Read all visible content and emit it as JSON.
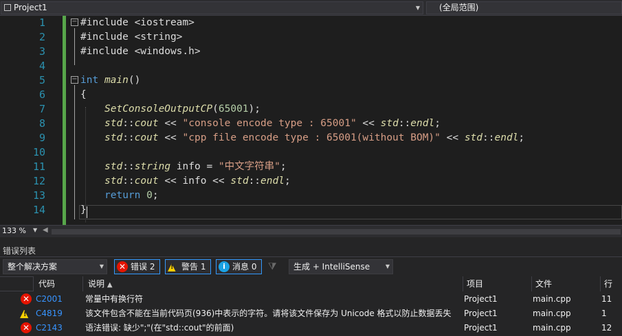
{
  "navbar": {
    "project": "Project1",
    "scope": "(全局范围)"
  },
  "editor": {
    "line_numbers": [
      "1",
      "2",
      "3",
      "4",
      "5",
      "6",
      "7",
      "8",
      "9",
      "10",
      "11",
      "12",
      "13",
      "14"
    ],
    "lines": {
      "l1": "#include <iostream>",
      "l2": "#include <string>",
      "l3": "#include <windows.h>",
      "l5_kw": "int",
      "l5_fn": "main",
      "l5_rest": "()",
      "l6": "{",
      "l7_fn": "SetConsoleOutputCP",
      "l7_open": "(",
      "l7_num": "65001",
      "l7_close": ");",
      "l8_ns": "std",
      "l8_sep": "::",
      "l8_cout": "cout",
      "l8_op": " << ",
      "l8_str": "\"console encode type : 65001\"",
      "l8_op2": " << ",
      "l8_ns2": "std",
      "l8_sep2": "::",
      "l8_endl": "endl",
      "l8_end": ";",
      "l9_ns": "std",
      "l9_sep": "::",
      "l9_cout": "cout",
      "l9_op": " << ",
      "l9_str": "\"cpp file encode type : 65001(without BOM)\"",
      "l9_op2": " << ",
      "l9_ns2": "std",
      "l9_sep2": "::",
      "l9_endl": "endl",
      "l9_end": ";",
      "l11_ns": "std",
      "l11_sep": "::",
      "l11_type": "string",
      "l11_rest": " info = ",
      "l11_str": "\"中文字符串\"",
      "l11_end": ";",
      "l12_ns": "std",
      "l12_sep": "::",
      "l12_cout": "cout",
      "l12_rest": " << info << ",
      "l12_ns2": "std",
      "l12_sep2": "::",
      "l12_endl": "endl",
      "l12_end": ";",
      "l13_kw": "return",
      "l13_num": " 0",
      "l13_end": ";",
      "l14": "}"
    }
  },
  "zoom": {
    "level": "133 %"
  },
  "errorlist": {
    "title": "错误列表",
    "scope_select": "整个解决方案",
    "errors_label": "错误 2",
    "warnings_label": "警告 1",
    "messages_label": "消息 0",
    "build_select": "生成 + IntelliSense",
    "columns": {
      "code": "代码",
      "desc": "说明",
      "sort": "▲",
      "project": "项目",
      "file": "文件",
      "line": "行"
    },
    "rows": [
      {
        "severity": "error",
        "code": "C2001",
        "desc": "常量中有换行符",
        "project": "Project1",
        "file": "main.cpp",
        "line": "11"
      },
      {
        "severity": "warning",
        "code": "C4819",
        "desc": "该文件包含不能在当前代码页(936)中表示的字符。请将该文件保存为 Unicode 格式以防止数据丢失",
        "project": "Project1",
        "file": "main.cpp",
        "line": "1"
      },
      {
        "severity": "error",
        "code": "C2143",
        "desc": "语法错误: 缺少\";\"(在\"std::cout\"的前面)",
        "project": "Project1",
        "file": "main.cpp",
        "line": "12"
      }
    ]
  },
  "colors": {
    "error": "#e51400",
    "warning": "#fcd000",
    "info": "#1ba1e2",
    "accent": "#3399ff"
  }
}
